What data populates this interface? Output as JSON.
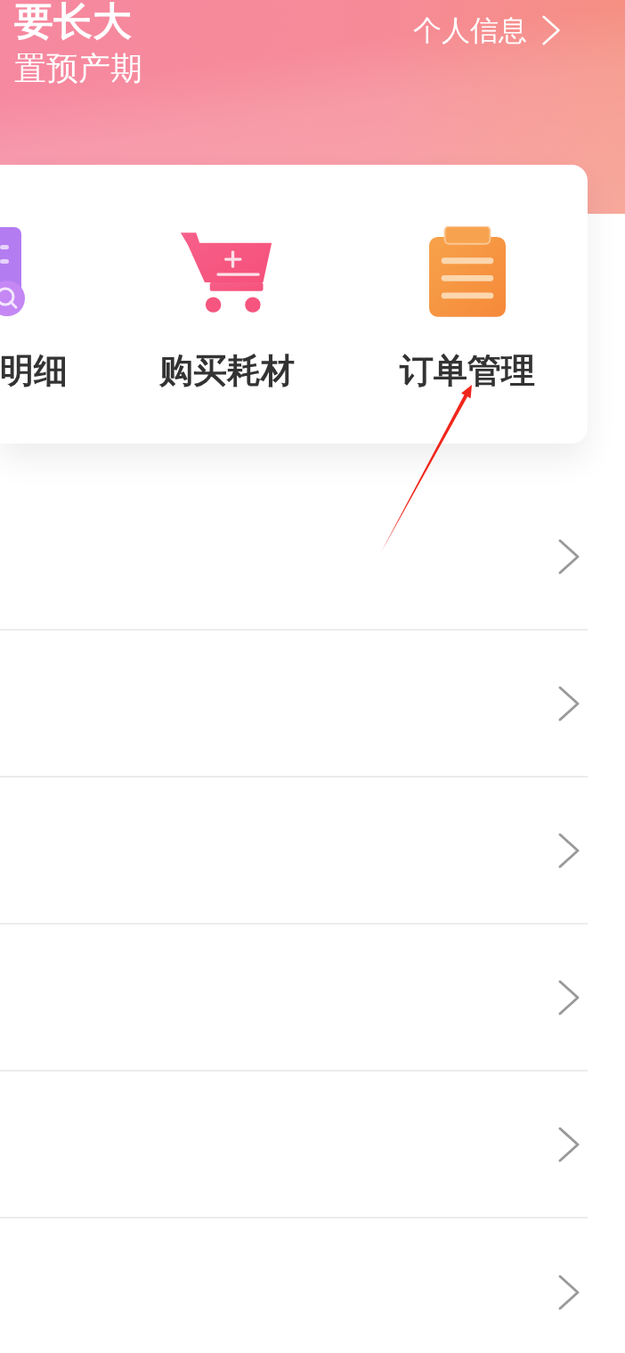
{
  "header": {
    "title": "要长大",
    "subtitle": "置预产期",
    "profile_link": "个人信息"
  },
  "shortcuts": [
    {
      "label": "明细"
    },
    {
      "label": "购买耗材"
    },
    {
      "label": "订单管理"
    }
  ],
  "menu_rows": [
    {
      "kind": "link"
    },
    {
      "kind": "link"
    },
    {
      "kind": "link"
    },
    {
      "kind": "link"
    },
    {
      "kind": "link"
    },
    {
      "kind": "link"
    }
  ]
}
